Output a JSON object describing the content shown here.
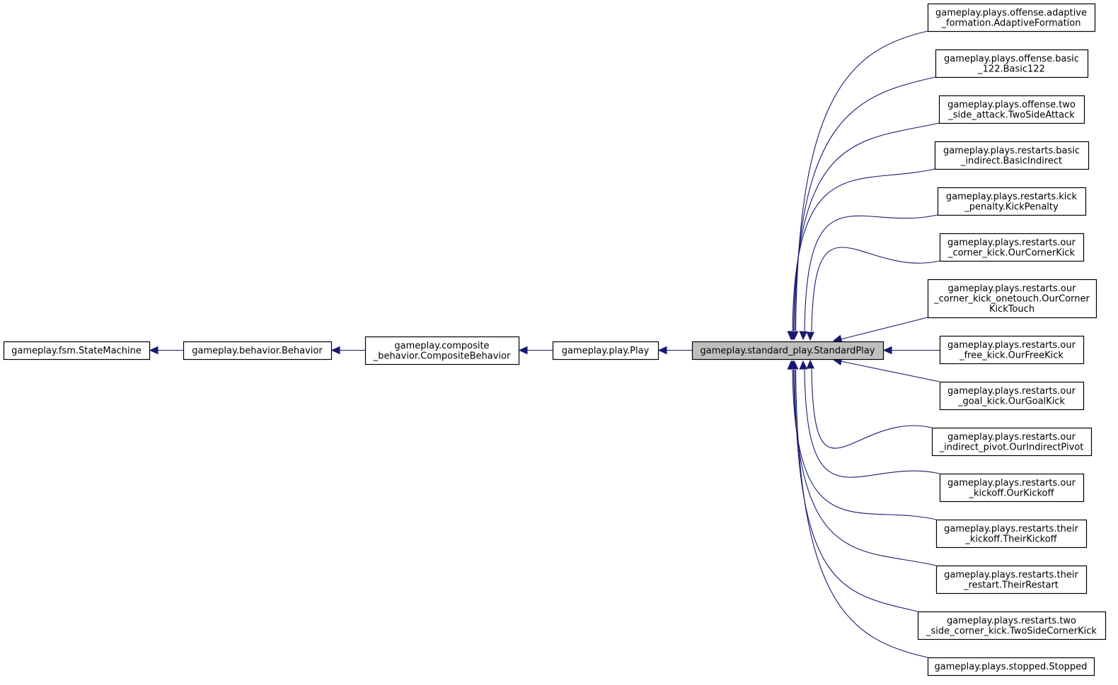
{
  "diagram": {
    "type": "inheritance-graph",
    "edge_color": "#191970",
    "highlight_fill": "#bfbfbf",
    "chain": [
      {
        "id": "statemachine",
        "lines": [
          "gameplay.fsm.StateMachine"
        ]
      },
      {
        "id": "behavior",
        "lines": [
          "gameplay.behavior.Behavior"
        ]
      },
      {
        "id": "compositebehavior",
        "lines": [
          "gameplay.composite",
          "_behavior.CompositeBehavior"
        ]
      },
      {
        "id": "play",
        "lines": [
          "gameplay.play.Play"
        ]
      },
      {
        "id": "standardplay",
        "lines": [
          "gameplay.standard_play.StandardPlay"
        ],
        "highlighted": true
      }
    ],
    "subclasses": [
      {
        "id": "adaptiveformation",
        "lines": [
          "gameplay.plays.offense.adaptive",
          "_formation.AdaptiveFormation"
        ]
      },
      {
        "id": "basic122",
        "lines": [
          "gameplay.plays.offense.basic",
          "_122.Basic122"
        ]
      },
      {
        "id": "twosideattack",
        "lines": [
          "gameplay.plays.offense.two",
          "_side_attack.TwoSideAttack"
        ]
      },
      {
        "id": "basicindirect",
        "lines": [
          "gameplay.plays.restarts.basic",
          "_indirect.BasicIndirect"
        ]
      },
      {
        "id": "kickpenalty",
        "lines": [
          "gameplay.plays.restarts.kick",
          "_penalty.KickPenalty"
        ]
      },
      {
        "id": "ourcornerkick",
        "lines": [
          "gameplay.plays.restarts.our",
          "_corner_kick.OurCornerKick"
        ]
      },
      {
        "id": "ourcornerkicktouch",
        "lines": [
          "gameplay.plays.restarts.our",
          "_corner_kick_onetouch.OurCorner",
          "KickTouch"
        ]
      },
      {
        "id": "ourfreekick",
        "lines": [
          "gameplay.plays.restarts.our",
          "_free_kick.OurFreeKick"
        ]
      },
      {
        "id": "ourgoalkick",
        "lines": [
          "gameplay.plays.restarts.our",
          "_goal_kick.OurGoalKick"
        ]
      },
      {
        "id": "ourindirectpivot",
        "lines": [
          "gameplay.plays.restarts.our",
          "_indirect_pivot.OurIndirectPivot"
        ]
      },
      {
        "id": "ourkickoff",
        "lines": [
          "gameplay.plays.restarts.our",
          "_kickoff.OurKickoff"
        ]
      },
      {
        "id": "theirkickoff",
        "lines": [
          "gameplay.plays.restarts.their",
          "_kickoff.TheirKickoff"
        ]
      },
      {
        "id": "theirrestart",
        "lines": [
          "gameplay.plays.restarts.their",
          "_restart.TheirRestart"
        ]
      },
      {
        "id": "twosidecornerkick",
        "lines": [
          "gameplay.plays.restarts.two",
          "_side_corner_kick.TwoSideCornerKick"
        ]
      },
      {
        "id": "stopped",
        "lines": [
          "gameplay.plays.stopped.Stopped"
        ]
      }
    ]
  }
}
